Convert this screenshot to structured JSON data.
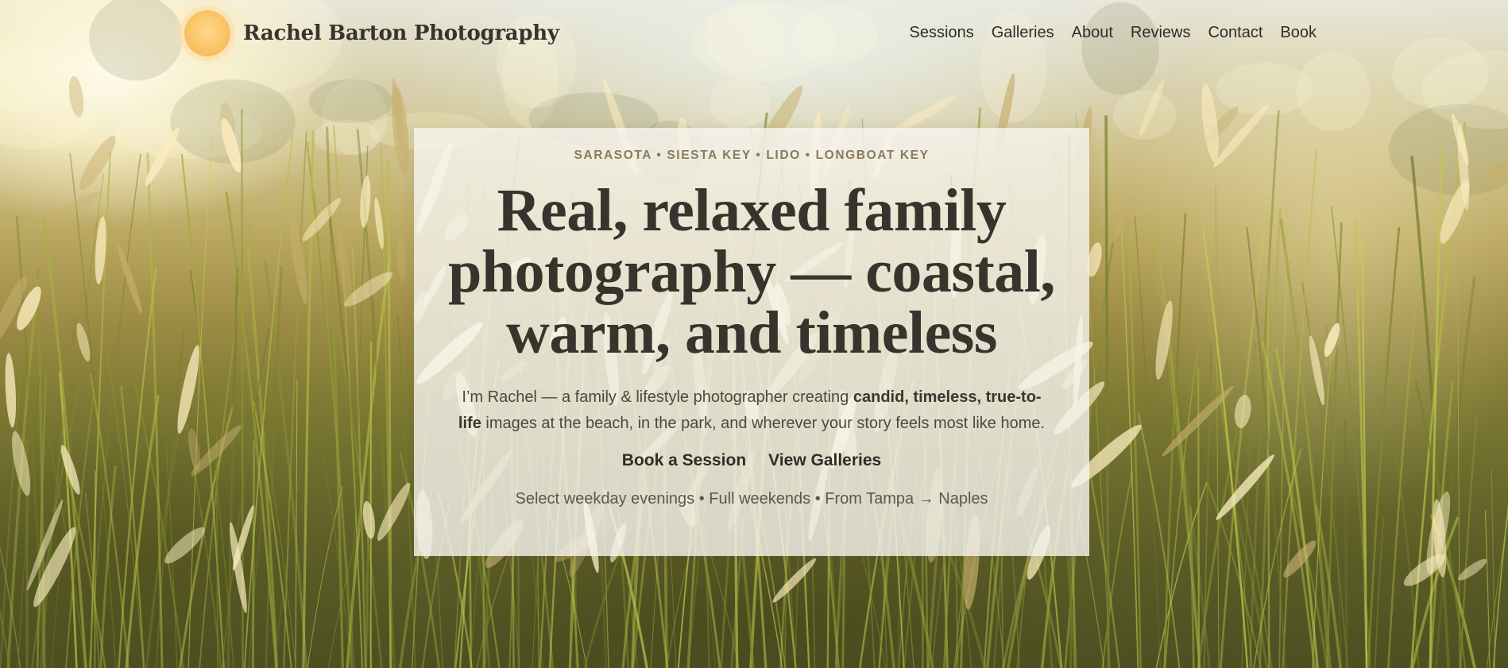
{
  "header": {
    "logo_text": "Rachel Barton Photography",
    "nav": [
      "Sessions",
      "Galleries",
      "About",
      "Reviews",
      "Contact",
      "Book"
    ]
  },
  "hero": {
    "locations": "SARASOTA • SIESTA KEY • LIDO • LONGBOAT KEY",
    "headline": "Real, relaxed family photography — coastal, warm, and timeless",
    "intro_start": "I’m Rachel — a family & lifestyle photographer creating ",
    "intro_bold": "candid, timeless, true-to-life",
    "intro_end": " images at the beach, in the park, and wherever your story feels most like home.",
    "primary_cta": "Book a Session",
    "secondary_cta": "View Galleries",
    "availability": "Select weekday evenings • Full weekends • From Tampa → Naples"
  },
  "colors": {
    "logo_sun": "#f9c467",
    "text_dark": "#38332c",
    "eyebrow": "#8a7a5c",
    "card_bg": "#f6f5f0"
  },
  "icons": {
    "logo": "sun-icon"
  }
}
